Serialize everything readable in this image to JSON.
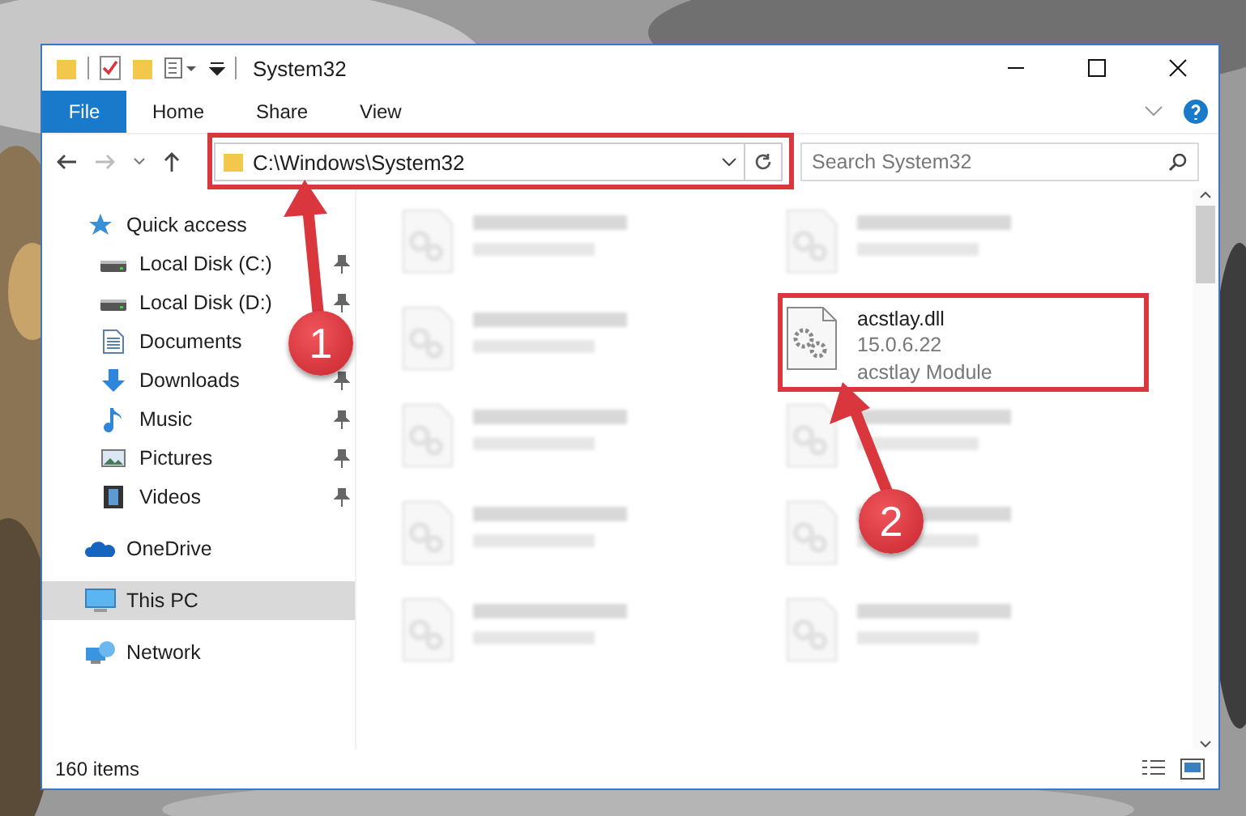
{
  "window": {
    "title": "System32"
  },
  "ribbon": {
    "tabs": [
      {
        "label": "File",
        "kind": "file"
      },
      {
        "label": "Home",
        "kind": "tab"
      },
      {
        "label": "Share",
        "kind": "tab"
      },
      {
        "label": "View",
        "kind": "tab"
      }
    ]
  },
  "address": {
    "path": "C:\\Windows\\System32"
  },
  "search": {
    "placeholder": "Search System32"
  },
  "nav": {
    "items": [
      {
        "label": "Quick access",
        "kind": "star",
        "selected": false,
        "children": [
          {
            "label": "Local Disk (C:)",
            "kind": "drive",
            "pinned": true,
            "selected": false
          },
          {
            "label": "Local Disk (D:)",
            "kind": "drive",
            "pinned": true,
            "selected": false
          },
          {
            "label": "Documents",
            "kind": "document",
            "selected": false
          },
          {
            "label": "Downloads",
            "kind": "download",
            "pinned": true,
            "selected": false
          },
          {
            "label": "Music",
            "kind": "music",
            "pinned": true,
            "selected": false
          },
          {
            "label": "Pictures",
            "kind": "picture",
            "pinned": true,
            "selected": false
          },
          {
            "label": "Videos",
            "kind": "video",
            "pinned": true,
            "selected": false
          }
        ]
      },
      {
        "label": "OneDrive",
        "kind": "cloud",
        "selected": false
      },
      {
        "label": "This PC",
        "kind": "computer",
        "selected": true
      },
      {
        "label": "Network",
        "kind": "network",
        "selected": false
      }
    ]
  },
  "files": [
    {
      "kind": "blurred"
    },
    {
      "kind": "blurred"
    },
    {
      "kind": "blurred"
    },
    {
      "kind": "file",
      "name": "acstlay.dll",
      "details": [
        "15.0.6.22",
        "acstlay Module"
      ]
    },
    {
      "kind": "blurred"
    },
    {
      "kind": "blurred"
    },
    {
      "kind": "blurred"
    },
    {
      "kind": "blurred"
    },
    {
      "kind": "blurred"
    },
    {
      "kind": "blurred"
    }
  ],
  "status_bar": {
    "count": "160 items"
  },
  "annotations": [
    {
      "label": "1"
    },
    {
      "label": "2"
    }
  ]
}
